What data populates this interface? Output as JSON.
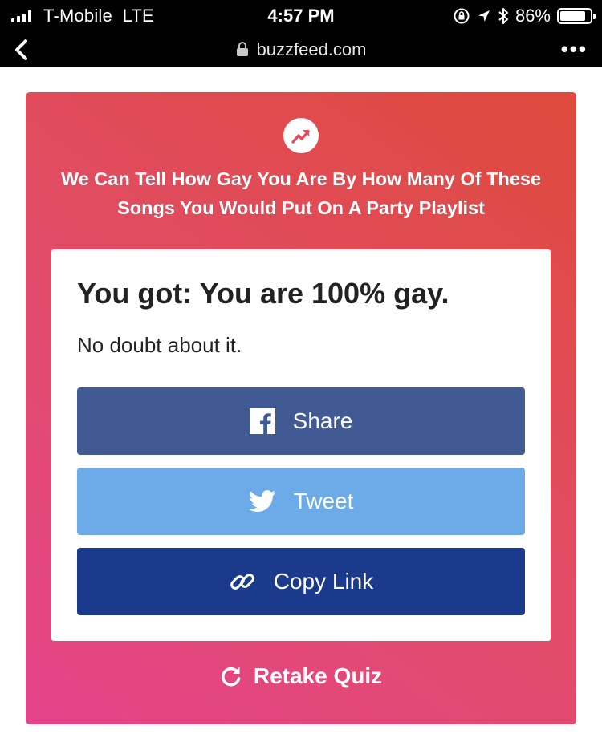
{
  "status_bar": {
    "carrier": "T-Mobile",
    "network": "LTE",
    "time": "4:57 PM",
    "battery": "86%",
    "battery_level": 0.86,
    "icons": [
      "signal-icon",
      "orientation-lock-icon",
      "location-arrow-icon",
      "bluetooth-icon",
      "battery-icon"
    ]
  },
  "browser": {
    "url": "buzzfeed.com",
    "icons": [
      "back-chevron-icon",
      "lock-icon",
      "more-options-icon"
    ]
  },
  "quiz": {
    "title": "We Can Tell How Gay You Are By How Many Of These Songs You Would Put On A Party Playlist",
    "result_heading": "You got: You are 100% gay.",
    "result_description": "No doubt about it.",
    "buttons": {
      "share": "Share",
      "tweet": "Tweet",
      "copy_link": "Copy Link"
    },
    "retake": "Retake Quiz",
    "icons": [
      "trending-icon",
      "facebook-icon",
      "twitter-icon",
      "link-icon",
      "retake-icon"
    ]
  },
  "colors": {
    "gradient_start": "#e4448b",
    "gradient_end": "#de4a3b",
    "facebook": "#425a94",
    "twitter": "#6daae8",
    "copy_link": "#1b3a8b"
  }
}
